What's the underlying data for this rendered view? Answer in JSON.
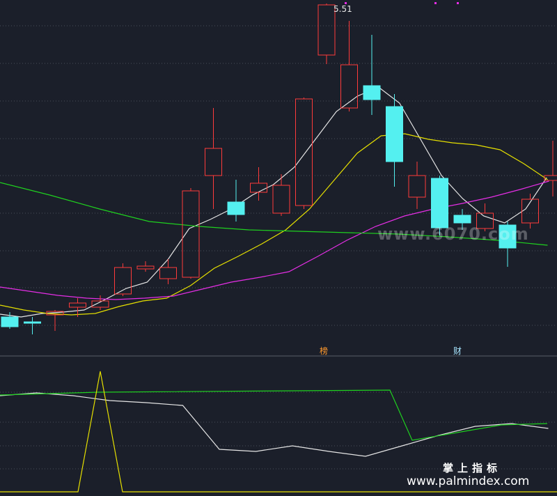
{
  "chart_data": {
    "type": "candlestick",
    "annotations": {
      "high_label": "5.51",
      "marker_1": "榜",
      "marker_2": "财"
    },
    "price_ylim": [
      0,
      510
    ],
    "candles": [
      {
        "o": 469,
        "c": 455,
        "h": 448,
        "l": 472,
        "up": false
      },
      {
        "o": 464,
        "c": 462,
        "h": 455,
        "l": 480,
        "up": false
      },
      {
        "o": 452,
        "c": 447,
        "h": 445,
        "l": 475,
        "up": true
      },
      {
        "o": 441,
        "c": 435,
        "h": 428,
        "l": 455,
        "up": true
      },
      {
        "o": 441,
        "c": 432,
        "h": 424,
        "l": 445,
        "up": true
      },
      {
        "o": 422,
        "c": 384,
        "h": 378,
        "l": 425,
        "up": true
      },
      {
        "o": 386,
        "c": 382,
        "h": 375,
        "l": 390,
        "up": true
      },
      {
        "o": 400,
        "c": 384,
        "h": 372,
        "l": 408,
        "up": true
      },
      {
        "o": 398,
        "c": 274,
        "h": 270,
        "l": 400,
        "up": true
      },
      {
        "o": 252,
        "c": 213,
        "h": 155,
        "l": 300,
        "up": true
      },
      {
        "o": 290,
        "c": 308,
        "h": 258,
        "l": 318,
        "up": false
      },
      {
        "o": 276,
        "c": 263,
        "h": 240,
        "l": 288,
        "up": true
      },
      {
        "o": 306,
        "c": 266,
        "h": 250,
        "l": 310,
        "up": true
      },
      {
        "o": 295,
        "c": 142,
        "h": 140,
        "l": 300,
        "up": true
      },
      {
        "o": 79,
        "c": 7,
        "h": 5,
        "l": 92,
        "up": true
      },
      {
        "o": 155,
        "c": 93,
        "h": 30,
        "l": 160,
        "up": true
      },
      {
        "o": 123,
        "c": 143,
        "h": 50,
        "l": 165,
        "up": false
      },
      {
        "o": 153,
        "c": 232,
        "h": 135,
        "l": 268,
        "up": false
      },
      {
        "o": 283,
        "c": 252,
        "h": 232,
        "l": 300,
        "up": true
      },
      {
        "o": 256,
        "c": 327,
        "h": 252,
        "l": 338,
        "up": false
      },
      {
        "o": 309,
        "c": 320,
        "h": 300,
        "l": 330,
        "up": false
      },
      {
        "o": 328,
        "c": 306,
        "h": 292,
        "l": 332,
        "up": true
      },
      {
        "o": 323,
        "c": 356,
        "h": 318,
        "l": 383,
        "up": false
      },
      {
        "o": 320,
        "c": 286,
        "h": 278,
        "l": 328,
        "up": true
      },
      {
        "o": 259,
        "c": 252,
        "h": 202,
        "l": 282,
        "up": true
      }
    ],
    "ma_white": [
      451,
      455,
      450,
      448,
      445,
      430,
      414,
      405,
      372,
      328,
      315,
      300,
      280,
      265,
      240,
      200,
      160,
      138,
      125,
      148,
      200,
      252,
      285,
      310,
      320,
      300,
      255
    ],
    "ma_yellow": [
      438,
      445,
      450,
      452,
      450,
      440,
      432,
      428,
      410,
      385,
      368,
      350,
      330,
      300,
      260,
      220,
      195,
      192,
      200,
      205,
      208,
      215,
      235,
      258
    ],
    "ma_magenta": [
      412,
      418,
      424,
      428,
      430,
      428,
      425,
      415,
      405,
      398,
      390,
      368,
      345,
      325,
      310,
      300,
      292,
      283,
      272,
      260
    ],
    "ma_green": [
      262,
      280,
      300,
      318,
      325,
      330,
      332,
      334,
      336,
      340,
      345,
      352
    ],
    "sub_white": [
      568,
      564,
      568,
      575,
      578,
      582,
      645,
      648,
      640,
      648,
      655,
      640,
      625,
      612,
      608,
      615
    ],
    "sub_green": [
      567,
      563,
      560,
      632,
      610,
      608
    ],
    "sub_yellow": [
      706,
      533,
      706,
      706
    ]
  },
  "watermark": {
    "mid": "www.6070.com",
    "cn": "掌上指标",
    "url": "www.palmindex.com"
  },
  "colors": {
    "bg": "#1b1f2a",
    "up": "#ff3b3b",
    "down": "#54f0f0",
    "ma_white": "#e6e6e6",
    "ma_yellow": "#e6e000",
    "ma_magenta": "#e62ee6",
    "ma_green": "#1fd11f",
    "grid": "#4a4f5a",
    "divider": "#5a5f68",
    "marker_orange": "#ff9a2e",
    "marker_cyan": "#a8e6ff"
  }
}
